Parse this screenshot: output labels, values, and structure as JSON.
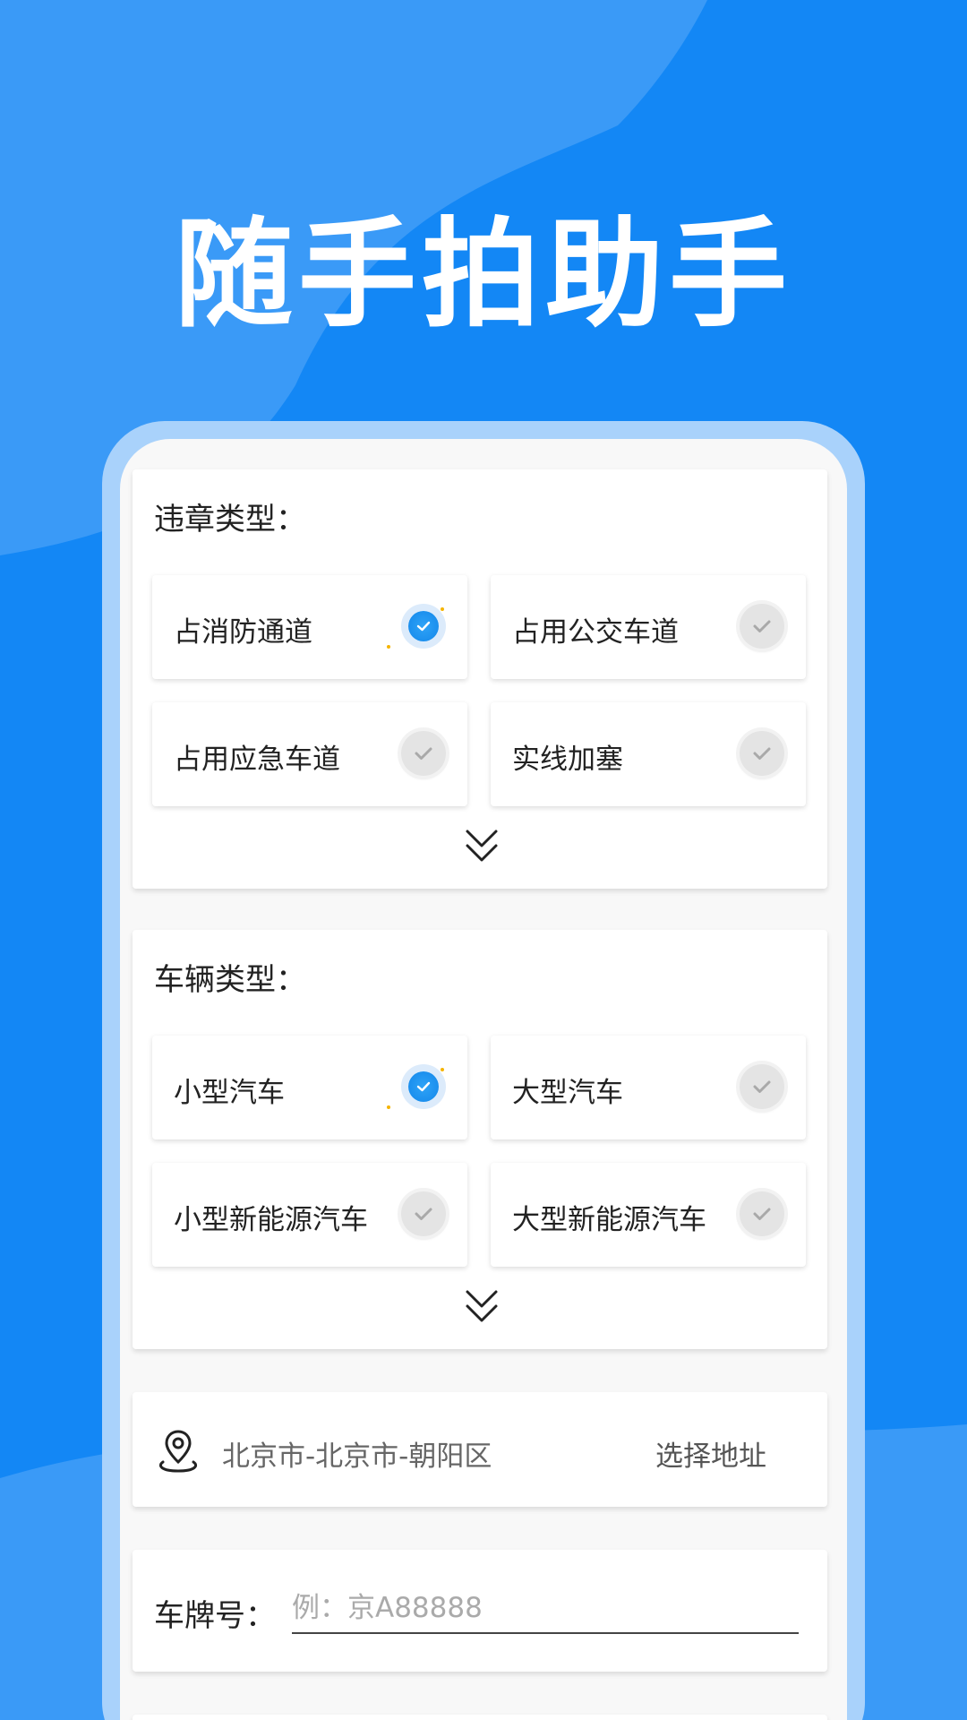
{
  "hero": {
    "title": "随手拍助手"
  },
  "violation": {
    "title": "违章类型：",
    "options": [
      {
        "label": "占消防通道",
        "checked": true
      },
      {
        "label": "占用公交车道",
        "checked": false
      },
      {
        "label": "占用应急车道",
        "checked": false
      },
      {
        "label": "实线加塞",
        "checked": false
      }
    ]
  },
  "vehicle": {
    "title": "车辆类型：",
    "options": [
      {
        "label": "小型汽车",
        "checked": true
      },
      {
        "label": "大型汽车",
        "checked": false
      },
      {
        "label": "小型新能源汽车",
        "checked": false
      },
      {
        "label": "大型新能源汽车",
        "checked": false
      }
    ]
  },
  "address": {
    "value": "北京市-北京市-朝阳区",
    "button": "选择地址"
  },
  "plate": {
    "label": "车牌号：",
    "placeholder": "例：京A88888",
    "value": ""
  },
  "colors": {
    "primary": "#1387f5",
    "accent": "#1487ea",
    "frame": "#a9d2fb"
  },
  "icons": {
    "expand": "double-chevron-down-icon",
    "location": "location-pin-icon",
    "check": "check-icon"
  }
}
